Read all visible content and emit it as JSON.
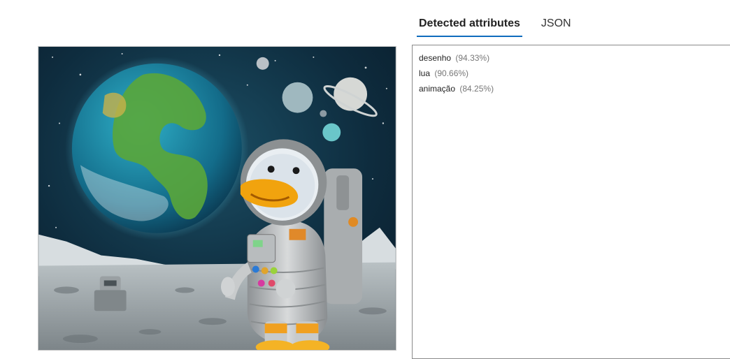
{
  "tabs": [
    {
      "label": "Detected attributes",
      "active": true
    },
    {
      "label": "JSON",
      "active": false
    }
  ],
  "attributes": [
    {
      "name": "desenho",
      "confidence": "(94.33%)"
    },
    {
      "name": "lua",
      "confidence": "(90.66%)"
    },
    {
      "name": "animação",
      "confidence": "(84.25%)"
    }
  ],
  "colors": {
    "tab_underline": "#0f6cbd",
    "results_border": "#8a8a8a"
  },
  "image": {
    "subject": "cartoon duck astronaut on the moon with earth and planets in the sky"
  }
}
